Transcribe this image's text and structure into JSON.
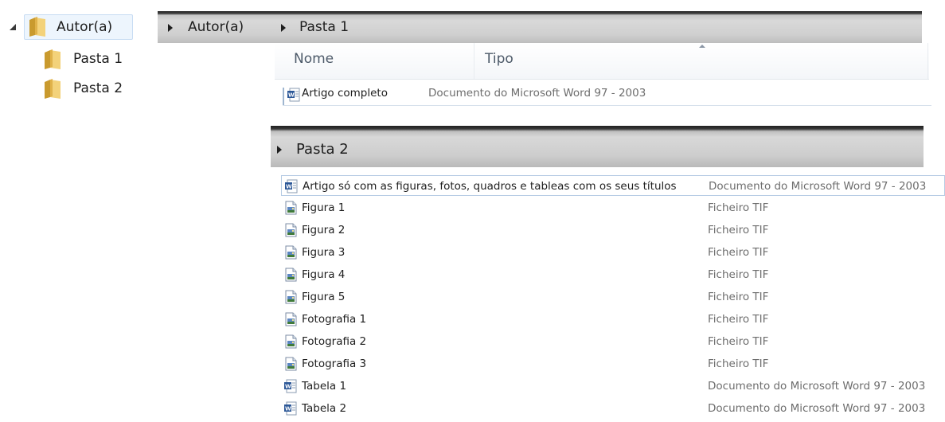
{
  "tree": {
    "items": [
      {
        "label": "Autor(a)",
        "selected": true,
        "expanded": true
      },
      {
        "label": "Pasta 1"
      },
      {
        "label": "Pasta 2"
      }
    ]
  },
  "breadcrumb1": [
    "Autor(a)",
    "Pasta 1"
  ],
  "columns": {
    "name": "Nome",
    "type": "Tipo"
  },
  "pasta1_files": [
    {
      "name": "Artigo completo",
      "type": "Documento do Microsoft Word 97 - 2003",
      "icon": "word-doc-icon"
    }
  ],
  "breadcrumb2": [
    "Pasta 2"
  ],
  "pasta2_files": [
    {
      "name": "Artigo só com as figuras, fotos, quadros e tableas com os seus títulos",
      "type": "Documento do Microsoft Word 97 - 2003",
      "icon": "word-doc-icon"
    },
    {
      "name": "Figura 1",
      "type": "Ficheiro TIF",
      "icon": "tif-image-icon"
    },
    {
      "name": "Figura 2",
      "type": "Ficheiro TIF",
      "icon": "tif-image-icon"
    },
    {
      "name": "Figura 3",
      "type": "Ficheiro TIF",
      "icon": "tif-image-icon"
    },
    {
      "name": "Figura 4",
      "type": "Ficheiro TIF",
      "icon": "tif-image-icon"
    },
    {
      "name": "Figura 5",
      "type": "Ficheiro TIF",
      "icon": "tif-image-icon"
    },
    {
      "name": "Fotografia 1",
      "type": "Ficheiro TIF",
      "icon": "tif-image-icon"
    },
    {
      "name": "Fotografia 2",
      "type": "Ficheiro TIF",
      "icon": "tif-image-icon"
    },
    {
      "name": "Fotografia 3",
      "type": "Ficheiro TIF",
      "icon": "tif-image-icon"
    },
    {
      "name": "Tabela 1",
      "type": "Documento do Microsoft Word 97 - 2003",
      "icon": "word-doc-icon"
    },
    {
      "name": "Tabela 2",
      "type": "Documento do Microsoft Word 97 - 2003",
      "icon": "word-doc-icon"
    }
  ],
  "colors": {
    "folder": "#e8c25a",
    "selection_bg": "#edf5fd",
    "selection_border": "#b6cbe4",
    "word_icon": "#2b5797",
    "type_text": "#6d6d6d"
  }
}
